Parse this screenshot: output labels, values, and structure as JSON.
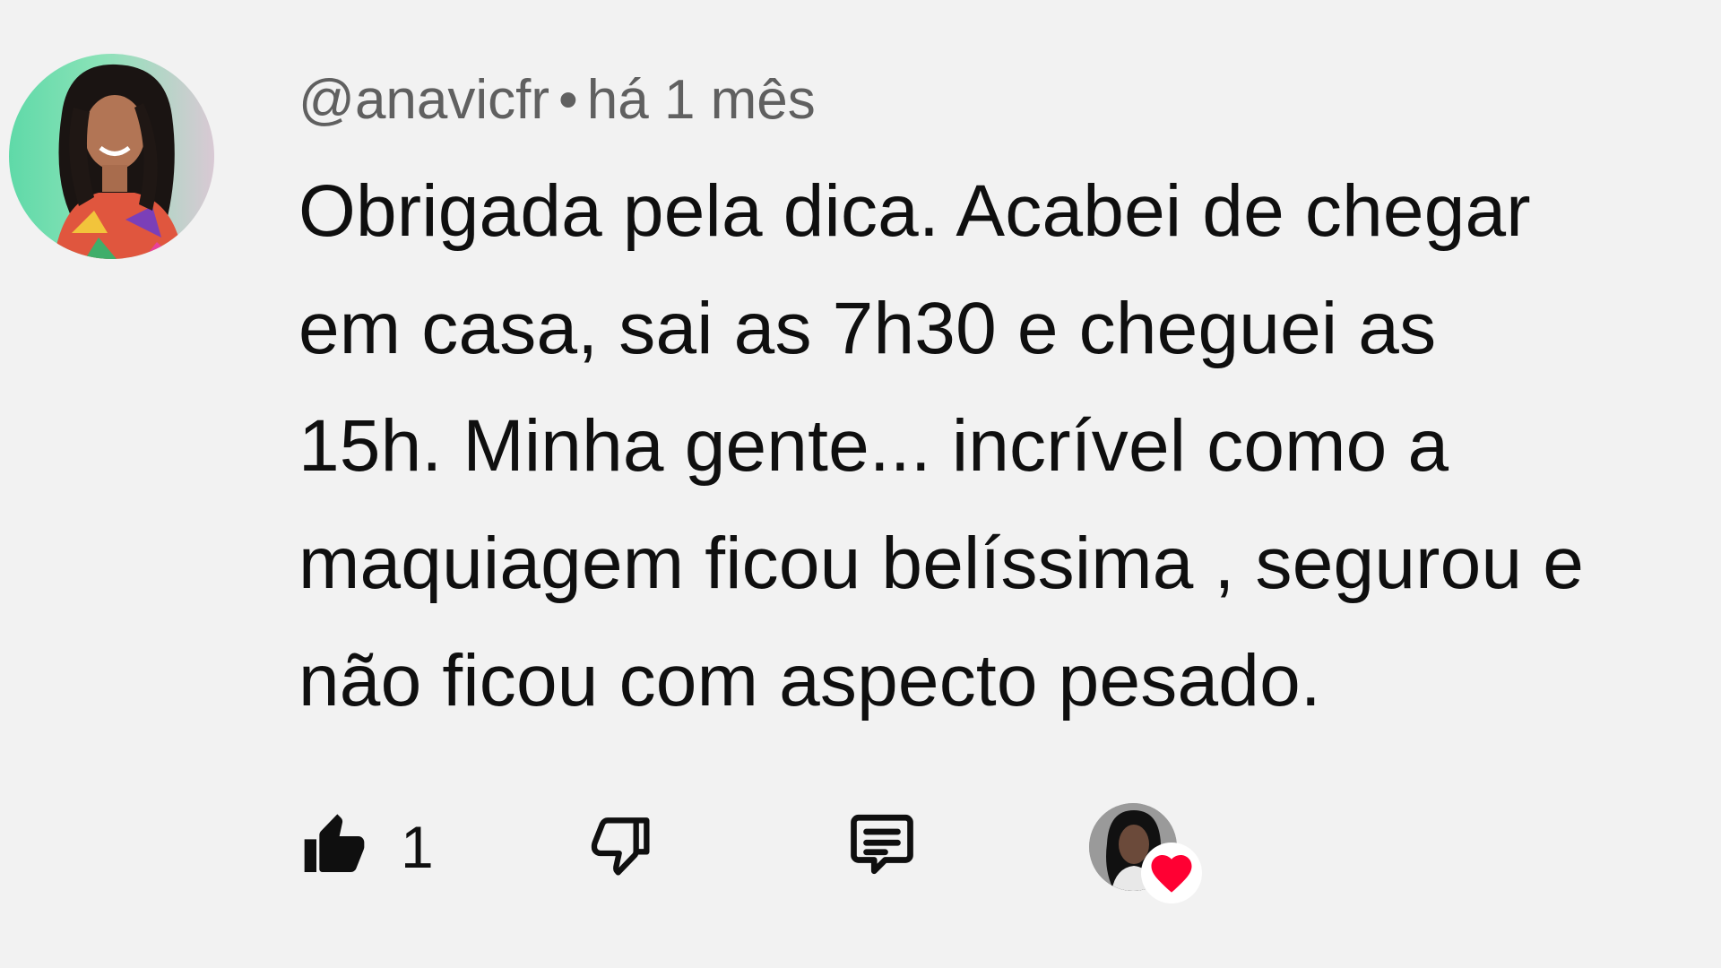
{
  "comment": {
    "author": "@anavicfr",
    "separator": "•",
    "timestamp": "há 1 mês",
    "text": "Obrigada pela dica. Acabei de chegar\nem casa, sai as 7h30 e cheguei as\n15h. Minha gente... incrível como a\nmaquiagem ficou belíssima , segurou e\nnão ficou com aspecto pesado."
  },
  "actions": {
    "like_count": "1"
  },
  "icons": {
    "like": "thumbs-up-filled-icon",
    "dislike": "thumbs-down-outline-icon",
    "reply": "comment-bubble-icon",
    "hearted": "heart-icon"
  },
  "colors": {
    "background": "#f2f2f2",
    "text": "#0f0f0f",
    "meta_text": "#606060",
    "heart": "#ff0033"
  }
}
